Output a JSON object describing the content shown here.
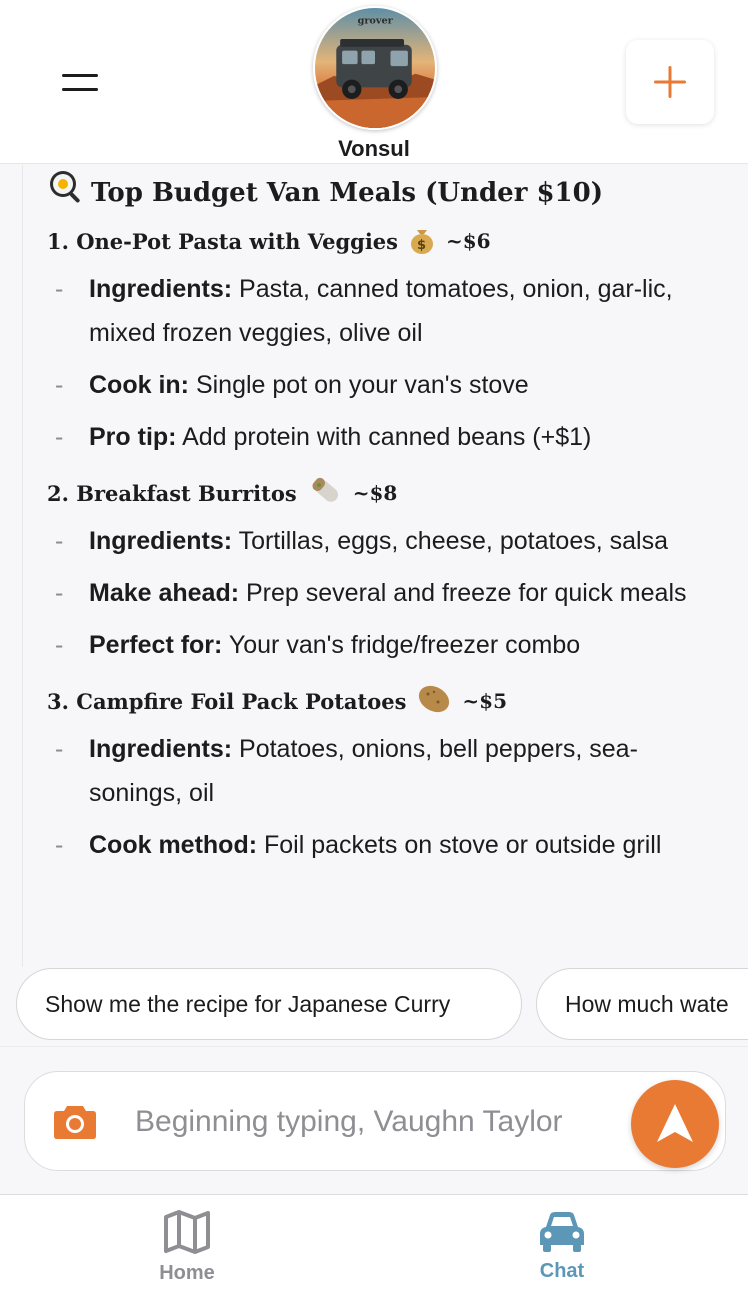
{
  "header": {
    "van_name": "Vonsul",
    "avatar_caption": "grover",
    "menu_icon": "hamburger-menu-icon",
    "add_icon": "plus-icon",
    "accent_color": "#e97a34"
  },
  "message": {
    "title": "Top Budget Van Meals (Under $10)",
    "title_emoji": "frying-pan-egg",
    "meals": [
      {
        "heading": "1. One-Pot Pasta with Veggies",
        "emoji": "money-bag",
        "price": "~$6",
        "bullets": [
          {
            "label": "Ingredients:",
            "text": " Pasta, canned tomatoes, onion, gar-lic, mixed frozen veggies, olive oil"
          },
          {
            "label": "Cook in:",
            "text": " Single pot on your van's stove"
          },
          {
            "label": "Pro tip:",
            "text": " Add protein with canned beans (+$1)"
          }
        ]
      },
      {
        "heading": "2. Breakfast Burritos",
        "emoji": "burrito",
        "price": "~$8",
        "bullets": [
          {
            "label": "Ingredients:",
            "text": " Tortillas, eggs, cheese, potatoes, salsa"
          },
          {
            "label": "Make ahead:",
            "text": " Prep several and freeze for quick meals"
          },
          {
            "label": "Perfect for:",
            "text": " Your van's fridge/freezer combo"
          }
        ]
      },
      {
        "heading": "3. Campfire Foil Pack Potatoes",
        "emoji": "potato",
        "price": "~$5",
        "bullets": [
          {
            "label": "Ingredients:",
            "text": " Potatoes, onions, bell peppers, sea-sonings, oil"
          },
          {
            "label": "Cook method:",
            "text": " Foil packets on stove or outside grill"
          }
        ]
      }
    ]
  },
  "suggestions": [
    "Show me the recipe for Japanese Curry",
    "How much wate"
  ],
  "composer": {
    "placeholder": "Beginning typing, Vaughn Taylor",
    "camera_icon": "camera-icon",
    "send_icon": "send-arrow-icon"
  },
  "tabs": [
    {
      "label": "Home",
      "icon": "map-icon",
      "active": false,
      "color": "#8e8e93"
    },
    {
      "label": "Chat",
      "icon": "car-icon",
      "active": true,
      "color": "#5d97b8"
    }
  ]
}
